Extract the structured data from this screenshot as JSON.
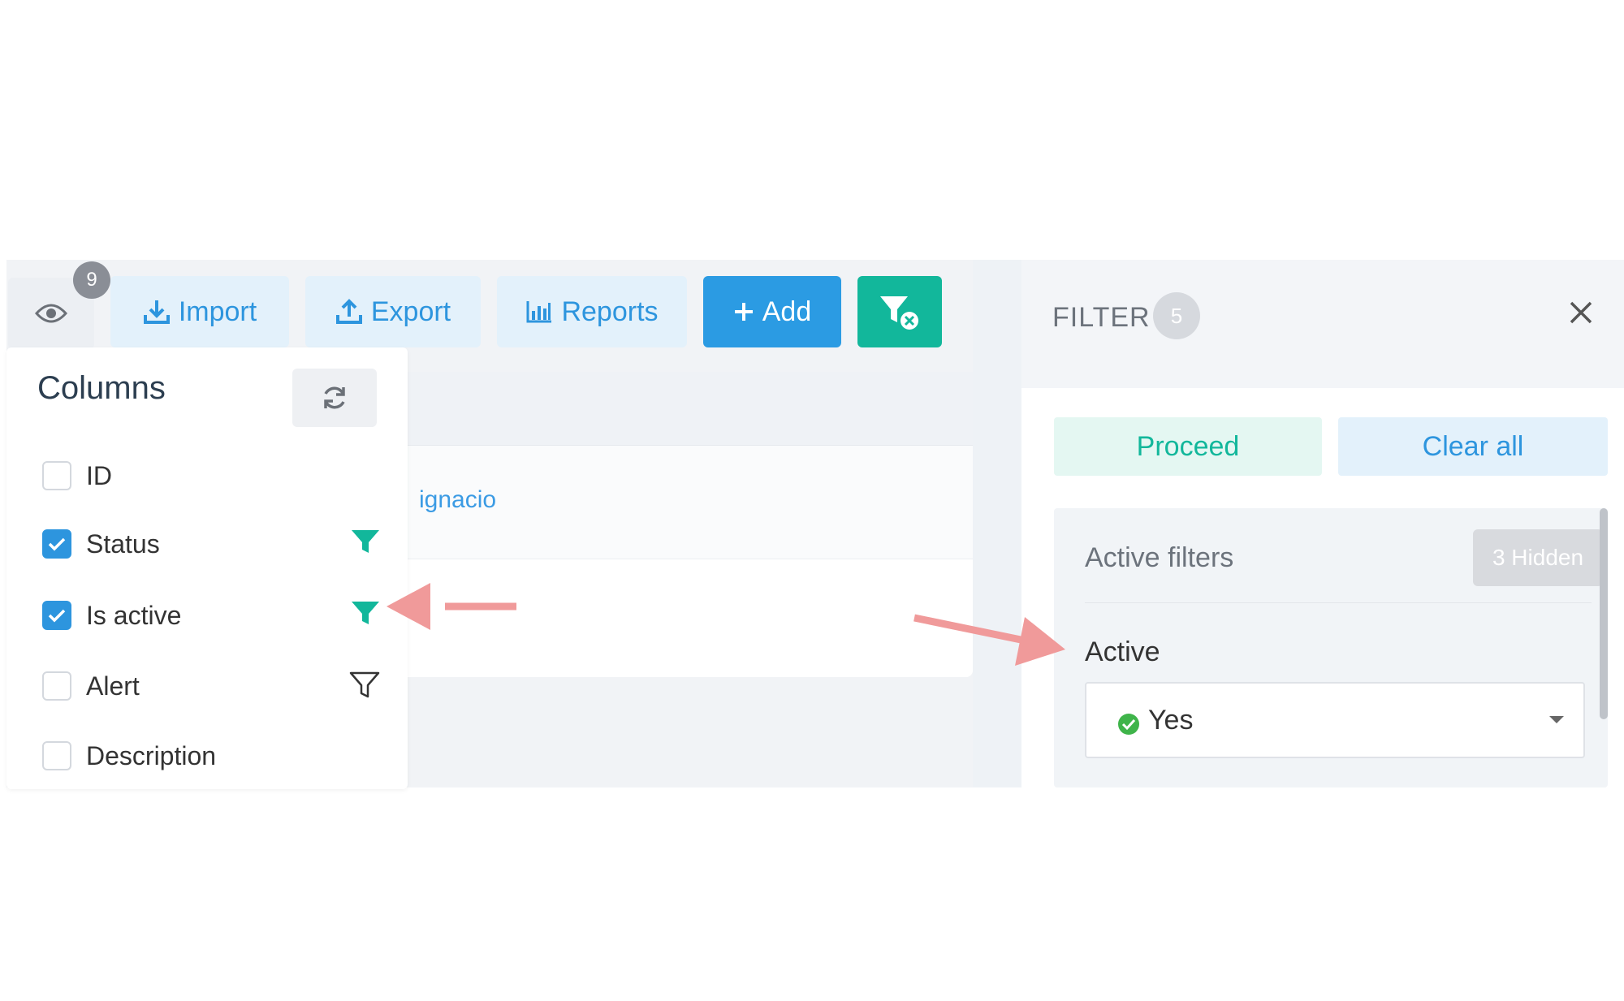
{
  "toolbar": {
    "columns_count": "9",
    "import_label": "Import",
    "export_label": "Export",
    "reports_label": "Reports",
    "add_label": "Add",
    "icons": {
      "columns": "eye-icon",
      "import": "download-icon",
      "export": "upload-icon",
      "reports": "bar-chart-icon",
      "add": "plus-icon",
      "filter": "filter-clear-icon"
    }
  },
  "table": {
    "row1_link": "ignacio"
  },
  "columns_panel": {
    "title": "Columns",
    "items": [
      {
        "label": "ID",
        "checked": false,
        "filter": "none"
      },
      {
        "label": "Status",
        "checked": true,
        "filter": "active"
      },
      {
        "label": "Is active",
        "checked": true,
        "filter": "active"
      },
      {
        "label": "Alert",
        "checked": false,
        "filter": "outline"
      },
      {
        "label": "Description",
        "checked": false,
        "filter": "none"
      }
    ]
  },
  "filter_panel": {
    "title": "FILTER",
    "count": "5",
    "proceed_label": "Proceed",
    "clear_label": "Clear all",
    "active_filters_title": "Active filters",
    "hidden_badge": "3 Hidden",
    "field_label": "Active",
    "field_value": "Yes"
  },
  "colors": {
    "accent_blue": "#2b9be3",
    "accent_green": "#12b79b",
    "annotation_arrow": "#f09a9a"
  }
}
